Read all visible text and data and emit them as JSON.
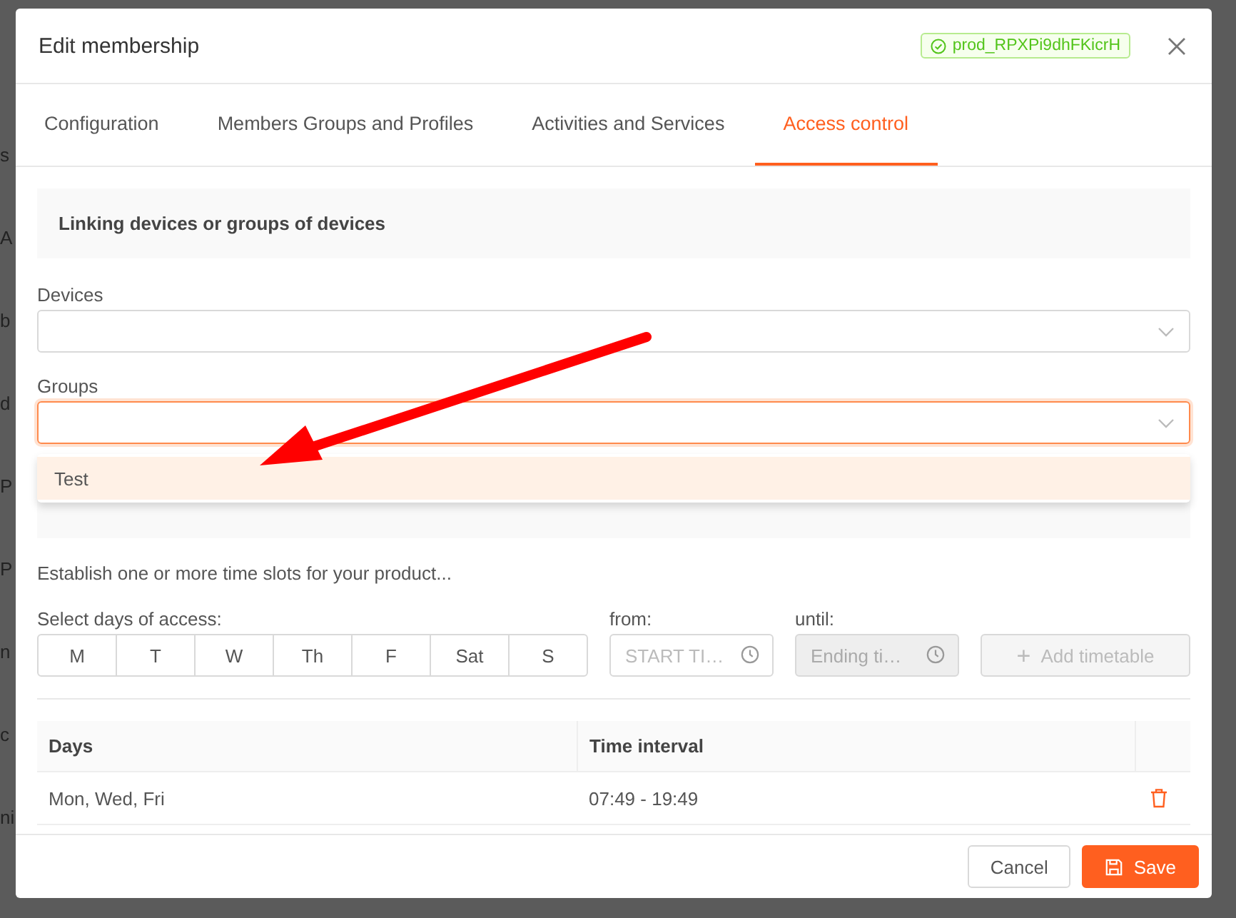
{
  "background_fragments": [
    "s",
    "A",
    "b",
    "d",
    "P",
    "P",
    "n",
    "c",
    "ni"
  ],
  "dialog": {
    "title": "Edit membership",
    "product_id": "prod_RPXPi9dhFKicrH"
  },
  "tabs": [
    {
      "label": "Configuration",
      "selected": false
    },
    {
      "label": "Members Groups and Profiles",
      "selected": false
    },
    {
      "label": "Activities and Services",
      "selected": false
    },
    {
      "label": "Access control",
      "selected": true
    }
  ],
  "linking": {
    "title": "Linking devices or groups of devices",
    "devices": {
      "label": "Devices",
      "focused": false
    },
    "groups": {
      "label": "Groups",
      "focused": true,
      "options": [
        {
          "label": "Test",
          "highlighted": true
        }
      ]
    }
  },
  "access_limit": {
    "hint": "Establish one or more time slots for your product...",
    "days_label": "Select days of access:",
    "days": [
      {
        "label": "M",
        "selected": false
      },
      {
        "label": "T",
        "selected": false
      },
      {
        "label": "W",
        "selected": false
      },
      {
        "label": "Th",
        "selected": false
      },
      {
        "label": "F",
        "selected": false
      },
      {
        "label": "Sat",
        "selected": false
      },
      {
        "label": "S",
        "selected": false
      }
    ],
    "from": {
      "label": "from:",
      "placeholder": "START TI…",
      "disabled": false
    },
    "until": {
      "label": "until:",
      "placeholder": "Ending ti…",
      "disabled": true
    },
    "add_button": {
      "label": "Add timetable",
      "icon": "+",
      "disabled": true
    }
  },
  "table": {
    "columns": [
      "Days",
      "Time interval"
    ],
    "rows": [
      {
        "days": "Mon, Wed, Fri",
        "interval": "07:49 - 19:49"
      }
    ]
  },
  "footer": {
    "cancel": "Cancel",
    "save": "Save"
  }
}
